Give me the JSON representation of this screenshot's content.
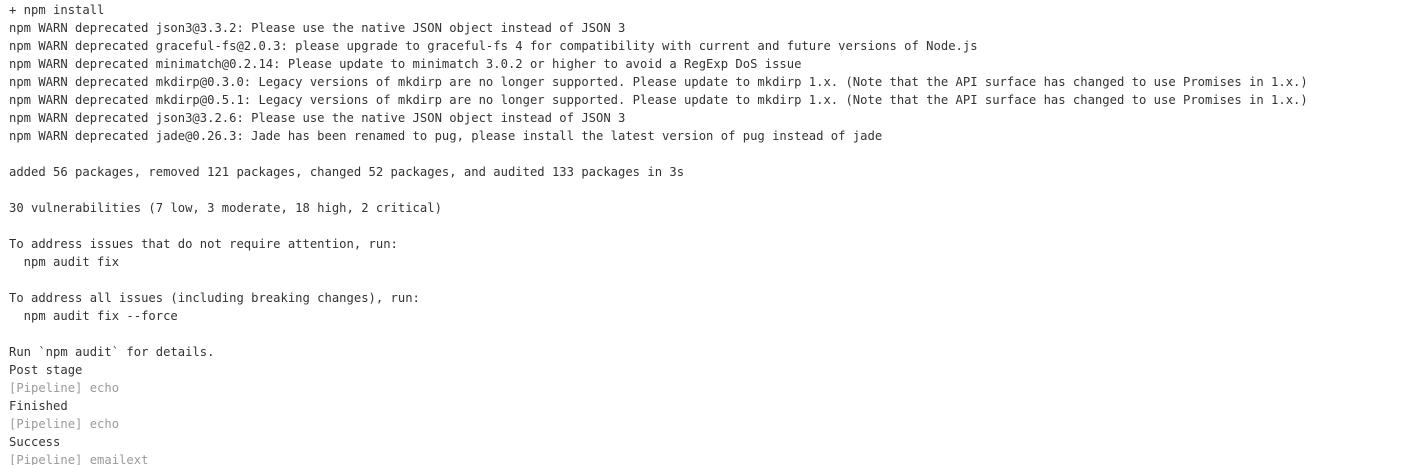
{
  "console": {
    "lines": [
      {
        "text": "+ npm install",
        "dim": false
      },
      {
        "text": "npm WARN deprecated json3@3.3.2: Please use the native JSON object instead of JSON 3",
        "dim": false
      },
      {
        "text": "npm WARN deprecated graceful-fs@2.0.3: please upgrade to graceful-fs 4 for compatibility with current and future versions of Node.js",
        "dim": false
      },
      {
        "text": "npm WARN deprecated minimatch@0.2.14: Please update to minimatch 3.0.2 or higher to avoid a RegExp DoS issue",
        "dim": false
      },
      {
        "text": "npm WARN deprecated mkdirp@0.3.0: Legacy versions of mkdirp are no longer supported. Please update to mkdirp 1.x. (Note that the API surface has changed to use Promises in 1.x.)",
        "dim": false
      },
      {
        "text": "npm WARN deprecated mkdirp@0.5.1: Legacy versions of mkdirp are no longer supported. Please update to mkdirp 1.x. (Note that the API surface has changed to use Promises in 1.x.)",
        "dim": false
      },
      {
        "text": "npm WARN deprecated json3@3.2.6: Please use the native JSON object instead of JSON 3",
        "dim": false
      },
      {
        "text": "npm WARN deprecated jade@0.26.3: Jade has been renamed to pug, please install the latest version of pug instead of jade",
        "dim": false
      },
      {
        "text": "",
        "dim": false
      },
      {
        "text": "added 56 packages, removed 121 packages, changed 52 packages, and audited 133 packages in 3s",
        "dim": false
      },
      {
        "text": "",
        "dim": false
      },
      {
        "text": "30 vulnerabilities (7 low, 3 moderate, 18 high, 2 critical)",
        "dim": false
      },
      {
        "text": "",
        "dim": false
      },
      {
        "text": "To address issues that do not require attention, run:",
        "dim": false
      },
      {
        "text": "  npm audit fix",
        "dim": false
      },
      {
        "text": "",
        "dim": false
      },
      {
        "text": "To address all issues (including breaking changes), run:",
        "dim": false
      },
      {
        "text": "  npm audit fix --force",
        "dim": false
      },
      {
        "text": "",
        "dim": false
      },
      {
        "text": "Run `npm audit` for details.",
        "dim": false
      },
      {
        "text": "Post stage",
        "dim": false
      },
      {
        "text": "[Pipeline] echo",
        "dim": true
      },
      {
        "text": "Finished",
        "dim": false
      },
      {
        "text": "[Pipeline] echo",
        "dim": true
      },
      {
        "text": "Success",
        "dim": false
      },
      {
        "text": "[Pipeline] emailext",
        "dim": true
      }
    ]
  }
}
